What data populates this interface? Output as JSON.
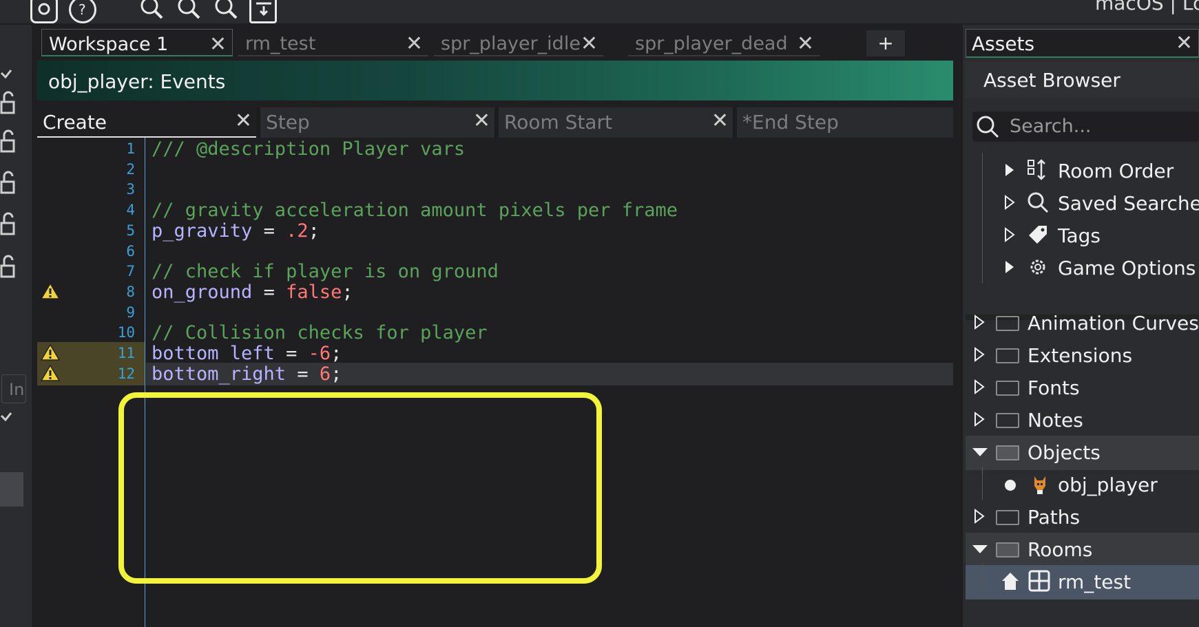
{
  "os_label": "macOS | Lo",
  "workspace_tabs": [
    {
      "label": "Workspace 1",
      "active": true
    },
    {
      "label": "rm_test"
    },
    {
      "label": "spr_player_idle"
    },
    {
      "label": "spr_player_dead"
    }
  ],
  "add_tab_label": "+",
  "object_header": "obj_player: Events",
  "event_tabs": [
    {
      "label": "Create",
      "active": true
    },
    {
      "label": "Step"
    },
    {
      "label": "Room Start"
    },
    {
      "label": "*End Step"
    }
  ],
  "strip_input_text": "In",
  "code": {
    "line_numbers": [
      "1",
      "2",
      "3",
      "4",
      "5",
      "6",
      "7",
      "8",
      "9",
      "10",
      "11",
      "12"
    ],
    "warning_lines": [
      8,
      11,
      12
    ],
    "highlighted_line": 12,
    "lines": [
      {
        "n": 1,
        "parts": [
          {
            "t": "/// @description Player vars",
            "c": "comment"
          }
        ]
      },
      {
        "n": 2,
        "parts": []
      },
      {
        "n": 3,
        "parts": []
      },
      {
        "n": 4,
        "parts": [
          {
            "t": "// gravity acceleration amount pixels per frame",
            "c": "comment"
          }
        ]
      },
      {
        "n": 5,
        "parts": [
          {
            "t": "p_gravity",
            "c": "var"
          },
          {
            "t": " = ",
            "c": "op"
          },
          {
            "t": ".2",
            "c": "num"
          },
          {
            "t": ";",
            "c": "op"
          }
        ]
      },
      {
        "n": 6,
        "parts": []
      },
      {
        "n": 7,
        "parts": [
          {
            "t": "// check if player is on ground",
            "c": "comment"
          }
        ]
      },
      {
        "n": 8,
        "parts": [
          {
            "t": "on_ground",
            "c": "var"
          },
          {
            "t": " = ",
            "c": "op"
          },
          {
            "t": "false",
            "c": "kw"
          },
          {
            "t": ";",
            "c": "op"
          }
        ]
      },
      {
        "n": 9,
        "parts": []
      },
      {
        "n": 10,
        "parts": [
          {
            "t": "// Collision checks for player",
            "c": "comment"
          }
        ]
      },
      {
        "n": 11,
        "parts": [
          {
            "t": "bottom_left",
            "c": "var"
          },
          {
            "t": " = ",
            "c": "op"
          },
          {
            "t": "-6",
            "c": "num"
          },
          {
            "t": ";",
            "c": "op"
          }
        ]
      },
      {
        "n": 12,
        "parts": [
          {
            "t": "bottom_right",
            "c": "var"
          },
          {
            "t": " = ",
            "c": "op"
          },
          {
            "t": "6",
            "c": "num"
          },
          {
            "t": ";",
            "c": "op"
          }
        ]
      }
    ]
  },
  "assets": {
    "tab_label": "Assets",
    "browser_title": "Asset Browser",
    "search_placeholder": "Search...",
    "tree_top": [
      {
        "label": "Room Order",
        "icon": "room-order-icon"
      },
      {
        "label": "Saved Searches",
        "icon": "search-icon"
      },
      {
        "label": "Tags",
        "icon": "tag-icon"
      },
      {
        "label": "Game Options",
        "icon": "gear-icon"
      }
    ],
    "tree_groups": [
      {
        "label": "Animation Curves",
        "expanded": false
      },
      {
        "label": "Extensions",
        "expanded": false
      },
      {
        "label": "Fonts",
        "expanded": false
      },
      {
        "label": "Notes",
        "expanded": false
      },
      {
        "label": "Objects",
        "expanded": true
      },
      {
        "label": "obj_player",
        "child": true
      },
      {
        "label": "Paths",
        "expanded": false
      },
      {
        "label": "Rooms",
        "expanded": true
      },
      {
        "label": "rm_test",
        "child": true
      }
    ]
  },
  "colors": {
    "accent": "#2f7d61",
    "callout": "#f3f43a",
    "line_number": "#3aa0d6",
    "comment": "#5aa35a",
    "variable": "#b7b3ff",
    "number": "#ff7777"
  }
}
